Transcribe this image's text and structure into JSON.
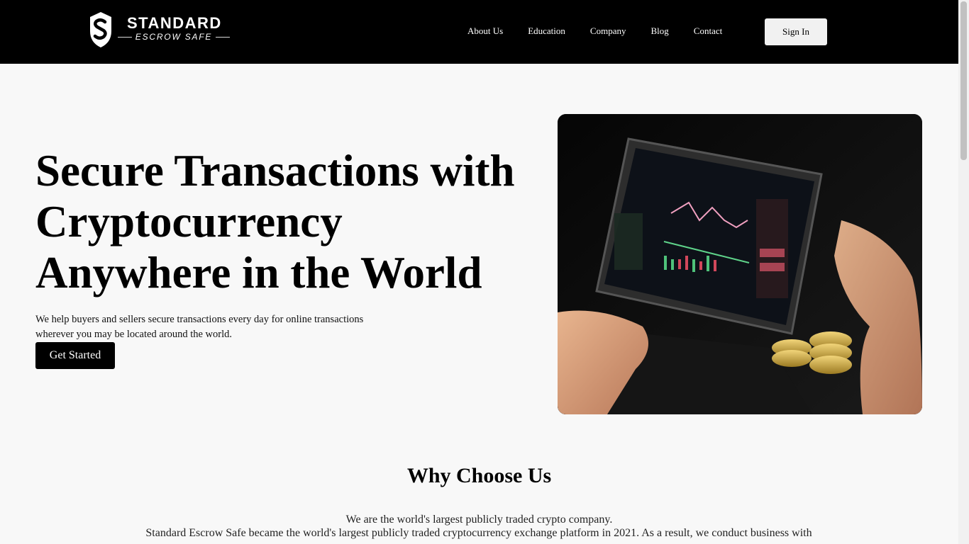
{
  "brand": {
    "name": "STANDARD",
    "tagline": "ESCROW SAFE"
  },
  "nav": {
    "items": [
      {
        "label": "About Us"
      },
      {
        "label": "Education"
      },
      {
        "label": "Company"
      },
      {
        "label": "Blog"
      },
      {
        "label": "Contact"
      }
    ],
    "signin_label": "Sign In"
  },
  "hero": {
    "title": "Secure Transactions with Cryptocurrency Anywhere in the World",
    "description": "We help buyers and sellers secure transactions every day for online transactions wherever you may be located around the world.",
    "cta_label": "Get Started",
    "image_icon": "laptop-trading-chart-with-coins-photo"
  },
  "why": {
    "title": "Why Choose Us",
    "lead": "We are the world's largest publicly traded crypto company.",
    "body": "Standard Escrow Safe became the world's largest publicly traded cryptocurrency exchange platform in 2021. As a result, we conduct business with"
  },
  "colors": {
    "header_bg": "#000000",
    "page_bg": "#f8f8f8",
    "button_dark": "#000000",
    "button_light": "#f1f1f1"
  }
}
